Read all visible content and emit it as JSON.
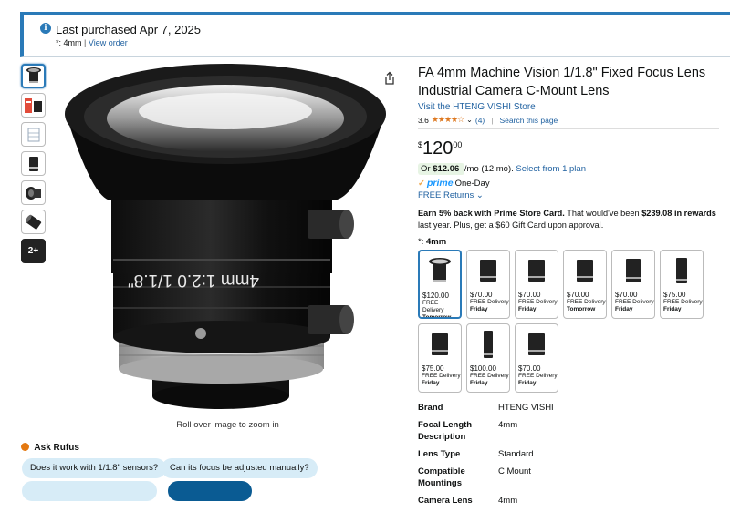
{
  "banner": {
    "title": "Last purchased Apr 7, 2025",
    "sub_prefix": "*: 4mm",
    "sub_sep": "|",
    "sub_link": "View order"
  },
  "gallery": {
    "more_label": "2+",
    "zoom_hint": "Roll over image to zoom in",
    "lens_text": "4mm 1:2.0 1/1.8\""
  },
  "rufus": {
    "title": "Ask Rufus",
    "chips": [
      "Does it work with 1/1.8\" sensors?",
      "Can its focus be adjusted manually?",
      "",
      ""
    ]
  },
  "product": {
    "title": "FA 4mm Machine Vision 1/1.8\" Fixed Focus Lens Industrial Camera C-Mount Lens",
    "store": "Visit the HTENG VISHI Store",
    "rating": "3.6",
    "stars": "★★★★☆",
    "rating_count": "(4)",
    "search_link": "Search this page",
    "price_symbol": "$",
    "price_whole": "120",
    "price_cents": "00",
    "monthly_prefix": "Or ",
    "monthly_amount": "$12.06",
    "monthly_suffix": "/mo (12 mo).",
    "monthly_link": "Select from 1 plan",
    "prime_label": "prime",
    "prime_delivery": "One-Day",
    "returns": "FREE Returns",
    "promo_lead": "Earn 5% back with Prime Store Card.",
    "promo_mid": " That would've been ",
    "promo_amount": "$239.08 in rewards",
    "promo_tail": " last year. Plus, get a $60 Gift Card upon approval.",
    "size_prefix": "*: ",
    "size_value": "4mm"
  },
  "swatches": [
    {
      "price": "$120.00",
      "line": "FREE Delivery",
      "day": "Tomorrow"
    },
    {
      "price": "$70.00",
      "line": "FREE Delivery",
      "day": "Friday"
    },
    {
      "price": "$70.00",
      "line": "FREE Delivery",
      "day": "Friday"
    },
    {
      "price": "$70.00",
      "line": "FREE Delivery",
      "day": "Tomorrow"
    },
    {
      "price": "$70.00",
      "line": "FREE Delivery",
      "day": "Friday"
    },
    {
      "price": "$75.00",
      "line": "FREE Delivery",
      "day": "Friday"
    },
    {
      "price": "$75.00",
      "line": "FREE Delivery",
      "day": "Friday"
    },
    {
      "price": "$100.00",
      "line": "FREE Delivery",
      "day": "Friday"
    },
    {
      "price": "$70.00",
      "line": "FREE Delivery",
      "day": "Friday"
    }
  ],
  "specs": [
    {
      "key": "Brand",
      "value": "HTENG VISHI"
    },
    {
      "key": "Focal Length Description",
      "value": "4mm"
    },
    {
      "key": "Lens Type",
      "value": "Standard"
    },
    {
      "key": "Compatible Mountings",
      "value": "C Mount"
    },
    {
      "key": "Camera Lens",
      "value": "4mm"
    }
  ],
  "colors": {
    "accent": "#2a7ab8",
    "link": "#2162a1",
    "star": "#de7921",
    "chip": "#d7ecf7"
  }
}
